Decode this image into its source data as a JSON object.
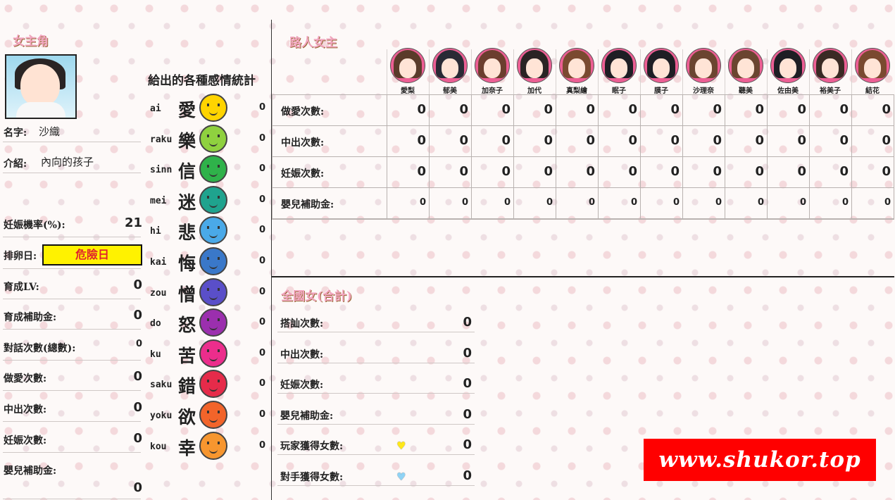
{
  "heroine": {
    "heading": "女主角",
    "name_label": "名字:",
    "name_value": "沙織",
    "intro_label": "介紹:",
    "intro_value": "內向的孩子",
    "stats": [
      {
        "label": "妊娠機率(%):",
        "value": "21"
      },
      {
        "label": "育成LV:",
        "value": "0"
      },
      {
        "label": "育成補助金:",
        "value": "0"
      },
      {
        "label": "對話次數(總數):",
        "value": "0"
      },
      {
        "label": "做愛次數:",
        "value": "0"
      },
      {
        "label": "中出次數:",
        "value": "0"
      },
      {
        "label": "妊娠次數:",
        "value": "0"
      },
      {
        "label": "嬰兒補助金:",
        "value": "0"
      }
    ],
    "ovulation_label": "排卵日:",
    "ovulation_value": "危險日"
  },
  "emotions": {
    "title": "給出的各種感情統計",
    "items": [
      {
        "romaji": "ai",
        "kanji": "愛",
        "value": "0",
        "color": "#ffd400"
      },
      {
        "romaji": "raku",
        "kanji": "樂",
        "value": "0",
        "color": "#8fd13f"
      },
      {
        "romaji": "sinn",
        "kanji": "信",
        "value": "0",
        "color": "#2fb24a"
      },
      {
        "romaji": "mei",
        "kanji": "迷",
        "value": "0",
        "color": "#1fa38e"
      },
      {
        "romaji": "hi",
        "kanji": "悲",
        "value": "0",
        "color": "#4aa9e8"
      },
      {
        "romaji": "kai",
        "kanji": "悔",
        "value": "0",
        "color": "#3a78c9"
      },
      {
        "romaji": "zou",
        "kanji": "憎",
        "value": "0",
        "color": "#5a4fc9"
      },
      {
        "romaji": "do",
        "kanji": "怒",
        "value": "0",
        "color": "#9b2fae"
      },
      {
        "romaji": "ku",
        "kanji": "苦",
        "value": "0",
        "color": "#ec2d8c"
      },
      {
        "romaji": "saku",
        "kanji": "錯",
        "value": "0",
        "color": "#e62b4a"
      },
      {
        "romaji": "yoku",
        "kanji": "欲",
        "value": "0",
        "color": "#f2642a"
      },
      {
        "romaji": "kou",
        "kanji": "幸",
        "value": "0",
        "color": "#f7962f"
      }
    ]
  },
  "passersby": {
    "heading": "路人女主",
    "names": [
      "愛梨",
      "郁美",
      "加奈子",
      "加代",
      "真梨繪",
      "眠子",
      "膜子",
      "沙理奈",
      "聽美",
      "佐由美",
      "裕美子",
      "結花"
    ],
    "hair_colors": [
      "#5a3b2a",
      "#2a2a35",
      "#6b3e2e",
      "#2a2424",
      "#7a4a30",
      "#1e1e24",
      "#1e1e24",
      "#6b4530",
      "#6b4530",
      "#1e1e24",
      "#3a2a24",
      "#7a4a30"
    ],
    "rows": [
      {
        "label": "做愛次數:",
        "values": [
          "0",
          "0",
          "0",
          "0",
          "0",
          "0",
          "0",
          "0",
          "0",
          "0",
          "0",
          "0"
        ]
      },
      {
        "label": "中出次數:",
        "values": [
          "0",
          "0",
          "0",
          "0",
          "0",
          "0",
          "0",
          "0",
          "0",
          "0",
          "0",
          "0"
        ]
      },
      {
        "label": "妊娠次數:",
        "values": [
          "0",
          "0",
          "0",
          "0",
          "0",
          "0",
          "0",
          "0",
          "0",
          "0",
          "0",
          "0"
        ]
      },
      {
        "label": "嬰兒補助金:",
        "values": [
          "0",
          "0",
          "0",
          "0",
          "0",
          "0",
          "0",
          "0",
          "0",
          "0",
          "0",
          "0"
        ]
      }
    ]
  },
  "national": {
    "heading": "全國女(合計)",
    "rows": [
      {
        "label": "搭訕次數:",
        "value": "0"
      },
      {
        "label": "中出次數:",
        "value": "0"
      },
      {
        "label": "妊娠次數:",
        "value": "0"
      },
      {
        "label": "嬰兒補助金:",
        "value": "0"
      },
      {
        "label": "玩家獲得女數:",
        "value": "0",
        "heart": "yellow-heart-icon",
        "heart_color": "#ffe81a"
      },
      {
        "label": "對手獲得女數:",
        "value": "0",
        "heart": "blue-heart-icon",
        "heart_color": "#8fd3f5"
      }
    ]
  },
  "banner": {
    "text": "www.shukor.top"
  }
}
